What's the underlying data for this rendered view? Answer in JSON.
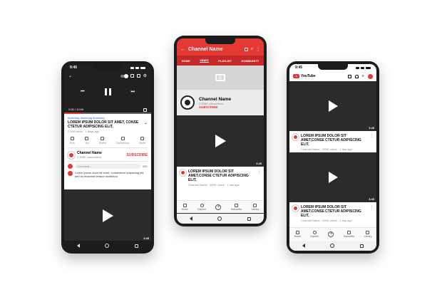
{
  "left_phone": {
    "time": "9:45",
    "progress": "2:00 / 10:00",
    "hashtags": "#hashtag #hashtag #hashtag",
    "video_title": "LOREM IPSUM DOLOR SIT AMET, CONSE CTETUR ADIPISCING ELIT,",
    "video_meta": "2,266 views · 1 days ago",
    "actions": [
      {
        "count": "52K",
        "icon": "thumbs-up-icon"
      },
      {
        "count": "1M",
        "icon": "thumbs-down-icon"
      },
      {
        "count": "Share",
        "icon": "share-icon"
      },
      {
        "count": "Download",
        "icon": "download-icon"
      },
      {
        "count": "Save",
        "icon": "save-icon"
      }
    ],
    "channel_name": "Channel Name",
    "subscribers": "2,308K subscribers",
    "subscribe": "SUBSCRIBE",
    "comment_placeholder": "Comment...",
    "comment_count": "22K",
    "comment_text": "Lorem ipsum dolor sit amet, consectetur adipiscing elit, sed do eiusmod tempor incididunt",
    "duration": "3.45"
  },
  "center_phone": {
    "title": "Channel Name",
    "tabs": [
      "HOME",
      "VIDEO",
      "PLAYLIST",
      "KOMMUNITY"
    ],
    "channel_name": "Channel Name",
    "subscribers": "2,308K subscribers",
    "subscribe": "SUBSCRIBE",
    "duration": "3.45",
    "video_title": "LOREM IPSUM DOLOR SIT AMET,CONSE CTETUR ADIPISCING ELIT,",
    "video_meta": "Channel Name · 320K views · 1 day ago",
    "bottom_nav": [
      "Home",
      "Explore",
      "",
      "Subscribe",
      "Library"
    ]
  },
  "right_phone": {
    "time": "9:45",
    "logo": "YouTube",
    "videos": [
      {
        "title": "LOREM IPSUM DOLOR SIT AMET,CONSE CTETUR ADIPISCING ELIT,",
        "meta": "Channel Name · 320K views · 1 day ago",
        "duration": "3.45"
      },
      {
        "title": "LOREM IPSUM DOLOR SIT AMET,CONSE CTETUR ADIPISCING ELIT,",
        "meta": "Channel Name · 320K views · 1 day ago",
        "duration": "3.45"
      }
    ],
    "bottom_nav": [
      "Home",
      "Explore",
      "",
      "Subscribe",
      "Library"
    ]
  },
  "colors": {
    "accent": "#e53935",
    "dark": "#1f1f1f"
  }
}
